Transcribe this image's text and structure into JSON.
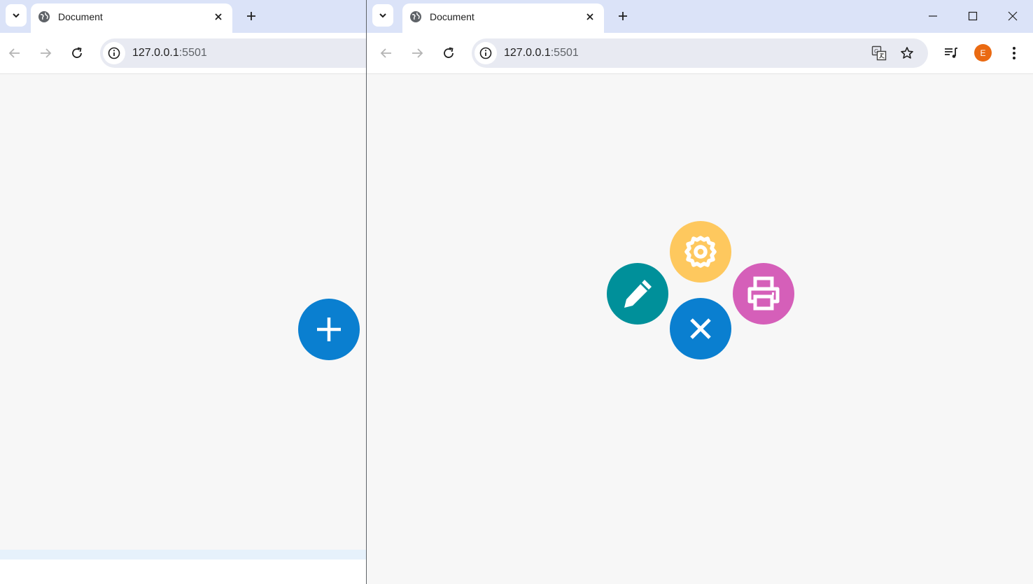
{
  "left_window": {
    "tab": {
      "title": "Document"
    },
    "address": {
      "host": "127.0.0.1",
      "port": ":5501"
    },
    "fab": {
      "icon": "plus-icon",
      "color": "#0a7fd0"
    }
  },
  "right_window": {
    "tab": {
      "title": "Document"
    },
    "address": {
      "host": "127.0.0.1",
      "port": ":5501"
    },
    "avatar_letter": "E",
    "menu_buttons": [
      {
        "icon": "gear-icon",
        "color": "#fec85e"
      },
      {
        "icon": "pencil-icon",
        "color": "#00909a"
      },
      {
        "icon": "printer-icon",
        "color": "#d55fb9"
      },
      {
        "icon": "close-icon",
        "color": "#0a7fd0"
      }
    ]
  }
}
